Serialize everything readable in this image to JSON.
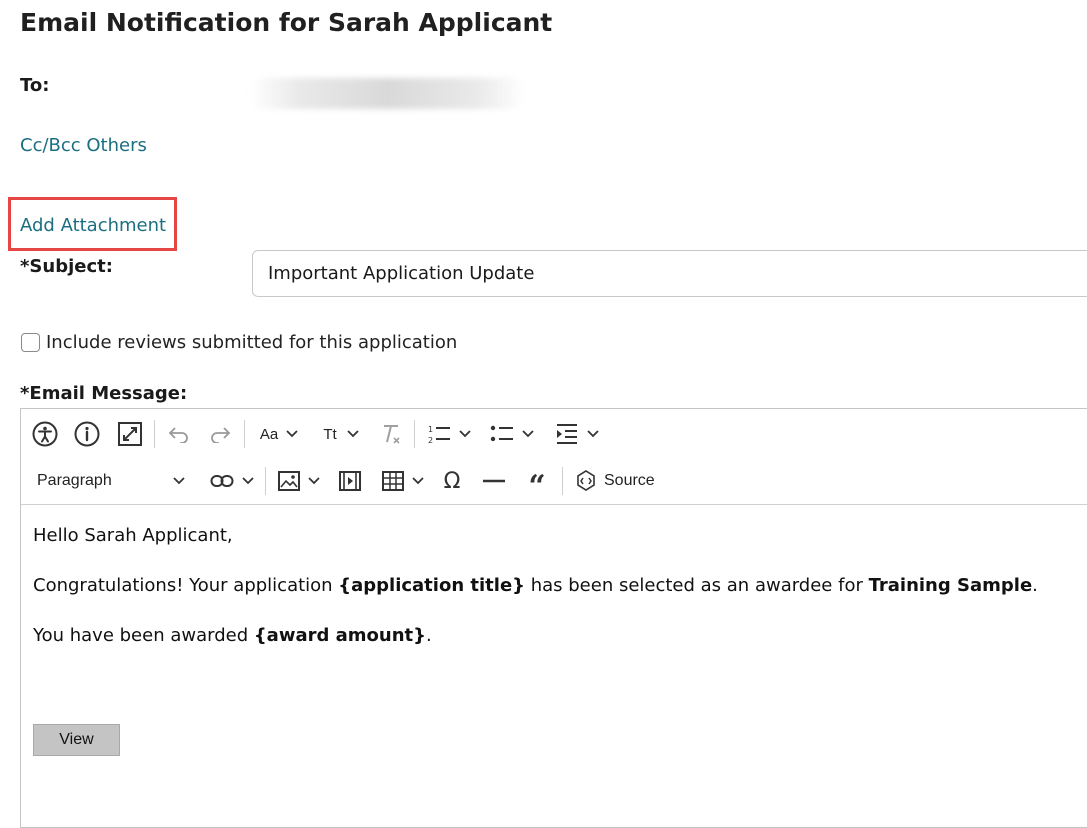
{
  "page": {
    "title": "Email Notification for Sarah Applicant"
  },
  "form": {
    "to_label": "To:",
    "cc_bcc_link": "Cc/Bcc Others",
    "add_attachment_link": "Add Attachment",
    "subject_label": "*Subject:",
    "subject_value": "Important Application Update",
    "include_reviews_label": "Include reviews submitted for this application",
    "include_reviews_checked": false,
    "email_message_label": "*Email Message:"
  },
  "editor": {
    "toolbar": {
      "row1_icons": [
        "accessibility-icon",
        "info-icon",
        "fullscreen-icon",
        "undo-icon",
        "redo-icon",
        "font-size-icon",
        "text-transform-icon",
        "remove-format-icon",
        "numbered-list-icon",
        "bulleted-list-icon",
        "indent-icon"
      ],
      "font_size_label": "Aa",
      "text_transform_label": "Tt",
      "paragraph_label": "Paragraph",
      "source_label": "Source"
    },
    "content": {
      "greeting": "Hello Sarah Applicant,",
      "line2_prefix": "Congratulations! Your application ",
      "line2_token": "{application title}",
      "line2_mid": " has been selected as an awardee for ",
      "line2_bold": "Training Sample",
      "line2_suffix": ".",
      "line3_prefix": "You have been awarded ",
      "line3_token": "{award amount}",
      "line3_suffix": ".",
      "view_button": "View"
    }
  },
  "colors": {
    "link": "#1b6f80",
    "highlight": "#e64545",
    "button_bg": "#c4c4c4"
  }
}
